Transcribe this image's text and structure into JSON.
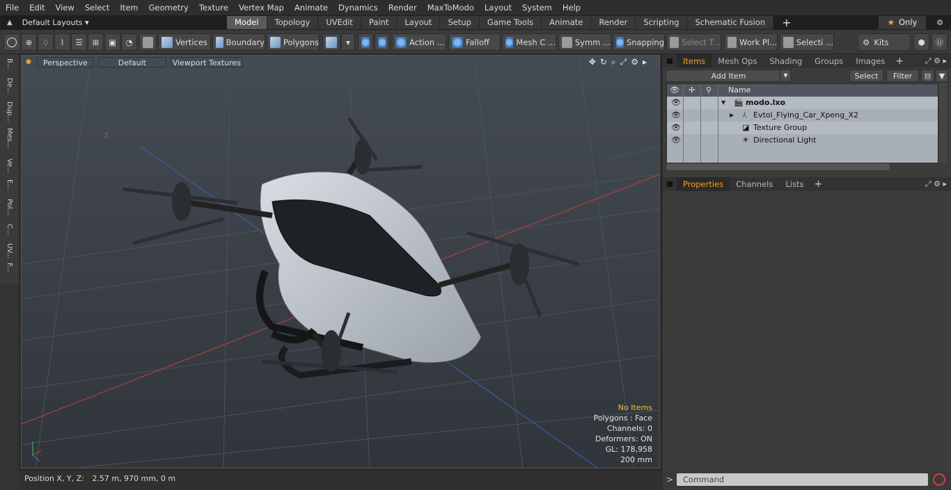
{
  "menu": [
    "File",
    "Edit",
    "View",
    "Select",
    "Item",
    "Geometry",
    "Texture",
    "Vertex Map",
    "Animate",
    "Dynamics",
    "Render",
    "MaxToModo",
    "Layout",
    "System",
    "Help"
  ],
  "layouts": {
    "label": "Default Layouts ▾"
  },
  "tabs": [
    "Model",
    "Topology",
    "UVEdit",
    "Paint",
    "Layout",
    "Setup",
    "Game Tools",
    "Animate",
    "Render",
    "Scripting",
    "Schematic Fusion"
  ],
  "active_tab": "Model",
  "only_label": "Only",
  "toolbar": {
    "vertices": "Vertices",
    "boundary": "Boundary",
    "polygons": "Polygons",
    "action": "Action  ...",
    "falloff": "Falloff",
    "mesh_c": "Mesh C ...",
    "symm": "Symm ...",
    "snapping": "Snapping",
    "select_t": "Select T...",
    "work_pl": "Work Pl...",
    "selecti": "Selecti ...",
    "kits": "Kits"
  },
  "left_strip": [
    "B...",
    "De...",
    "Dup...",
    "Mes...",
    "Ve...",
    "E...",
    "Pol...",
    "C...",
    "UV...",
    "F..."
  ],
  "viewport": {
    "perspective": "Perspective",
    "default": "Default",
    "textures": "Viewport Textures",
    "stats": {
      "no_items": "No Items",
      "polygons": "Polygons : Face",
      "channels": "Channels: 0",
      "deformers": "Deformers: ON",
      "gl": "GL: 178,958",
      "size": "200 mm"
    },
    "axis_z": "Z"
  },
  "status": {
    "label": "Position X, Y, Z:",
    "value": "2.57 m, 970 mm, 0 m"
  },
  "items_panel": {
    "tabs": [
      "Items",
      "Mesh Ops",
      "Shading",
      "Groups",
      "Images"
    ],
    "add_item": "Add Item",
    "select": "Select",
    "filter": "Filter",
    "name_header": "Name",
    "tree": [
      {
        "label": "modo.lxo"
      },
      {
        "label": "Evtol_Flying_Car_Xpeng_X2"
      },
      {
        "label": "Texture Group"
      },
      {
        "label": "Directional Light"
      }
    ]
  },
  "props_panel": {
    "tabs": [
      "Properties",
      "Channels",
      "Lists"
    ]
  },
  "command": {
    "placeholder": "Command"
  }
}
